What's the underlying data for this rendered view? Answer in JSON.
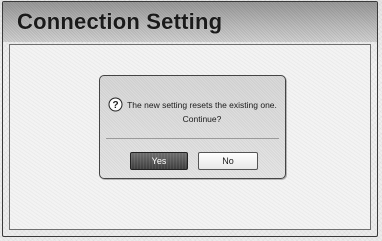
{
  "screen": {
    "title": "Connection Setting"
  },
  "dialog": {
    "icon": "question-icon",
    "message_line1": "The new setting resets the existing one.",
    "message_line2": "Continue?",
    "yes_label": "Yes",
    "no_label": "No",
    "selected_button": "Yes"
  }
}
